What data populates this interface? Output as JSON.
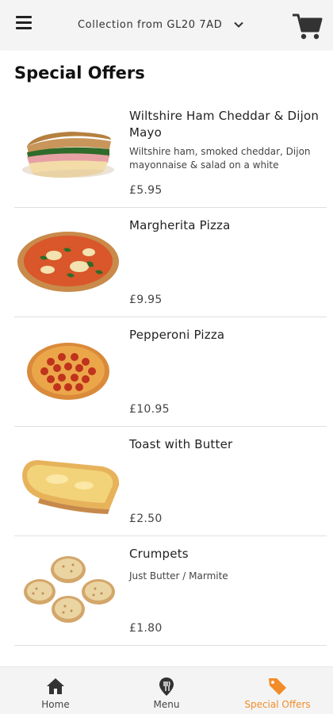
{
  "header": {
    "location_label": "Collection from GL20 7AD"
  },
  "page": {
    "title": "Special Offers"
  },
  "items": [
    {
      "name": "Wiltshire Ham Cheddar & Dijon Mayo",
      "description": "Wiltshire ham, smoked cheddar, Dijon mayonnaise & salad on a white",
      "price": "£5.95",
      "image": "sandwich"
    },
    {
      "name": "Margherita Pizza",
      "description": "",
      "price": "£9.95",
      "image": "margherita-pizza"
    },
    {
      "name": "Pepperoni Pizza",
      "description": "",
      "price": "£10.95",
      "image": "pepperoni-pizza"
    },
    {
      "name": "Toast with Butter",
      "description": "",
      "price": "£2.50",
      "image": "toast"
    },
    {
      "name": "Crumpets",
      "description": "Just Butter / Marmite",
      "price": "£1.80",
      "image": "crumpets"
    }
  ],
  "nav": {
    "tabs": [
      {
        "label": "Home",
        "icon": "home-icon"
      },
      {
        "label": "Menu",
        "icon": "map-pin-icon"
      },
      {
        "label": "Special Offers",
        "icon": "tag-icon",
        "active": true
      }
    ]
  },
  "colors": {
    "accent": "#f28c28",
    "bar_background": "#f4f4f4"
  }
}
